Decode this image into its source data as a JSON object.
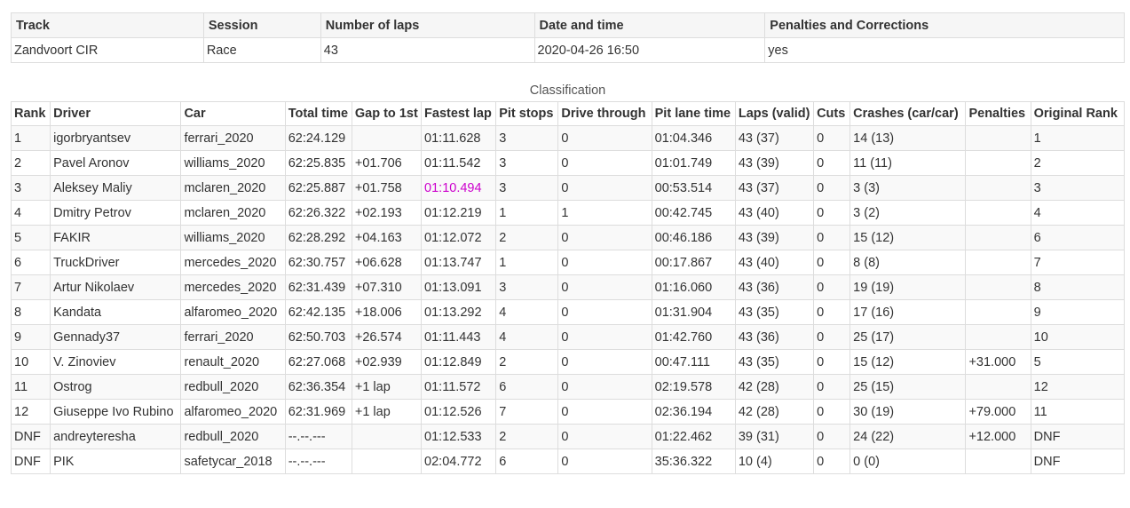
{
  "session": {
    "headers": [
      "Track",
      "Session",
      "Number of laps",
      "Date and time",
      "Penalties and Corrections"
    ],
    "values": [
      "Zandvoort CIR",
      "Race",
      "43",
      "2020-04-26 16:50",
      "yes"
    ]
  },
  "classification": {
    "caption": "Classification",
    "headers": [
      "Rank",
      "Driver",
      "Car",
      "Total time",
      "Gap to 1st",
      "Fastest lap",
      "Pit stops",
      "Drive through",
      "Pit lane time",
      "Laps (valid)",
      "Cuts",
      "Crashes (car/car)",
      "Penalties",
      "Original Rank"
    ],
    "highlight_color": "#cc00cc",
    "rows": [
      [
        "1",
        "igorbryantsev",
        "ferrari_2020",
        "62:24.129",
        "",
        "01:11.628",
        "3",
        "0",
        "01:04.346",
        "43 (37)",
        "0",
        "14 (13)",
        "",
        "1"
      ],
      [
        "2",
        "Pavel Aronov",
        "williams_2020",
        "62:25.835",
        "+01.706",
        "01:11.542",
        "3",
        "0",
        "01:01.749",
        "43 (39)",
        "0",
        "11 (11)",
        "",
        "2"
      ],
      [
        "3",
        "Aleksey Maliy",
        "mclaren_2020",
        "62:25.887",
        "+01.758",
        "01:10.494",
        "3",
        "0",
        "00:53.514",
        "43 (37)",
        "0",
        "3 (3)",
        "",
        "3"
      ],
      [
        "4",
        "Dmitry Petrov",
        "mclaren_2020",
        "62:26.322",
        "+02.193",
        "01:12.219",
        "1",
        "1",
        "00:42.745",
        "43 (40)",
        "0",
        "3 (2)",
        "",
        "4"
      ],
      [
        "5",
        "FAKIR",
        "williams_2020",
        "62:28.292",
        "+04.163",
        "01:12.072",
        "2",
        "0",
        "00:46.186",
        "43 (39)",
        "0",
        "15 (12)",
        "",
        "6"
      ],
      [
        "6",
        "TruckDriver",
        "mercedes_2020",
        "62:30.757",
        "+06.628",
        "01:13.747",
        "1",
        "0",
        "00:17.867",
        "43 (40)",
        "0",
        "8 (8)",
        "",
        "7"
      ],
      [
        "7",
        "Artur Nikolaev",
        "mercedes_2020",
        "62:31.439",
        "+07.310",
        "01:13.091",
        "3",
        "0",
        "01:16.060",
        "43 (36)",
        "0",
        "19 (19)",
        "",
        "8"
      ],
      [
        "8",
        "Kandata",
        "alfaromeo_2020",
        "62:42.135",
        "+18.006",
        "01:13.292",
        "4",
        "0",
        "01:31.904",
        "43 (35)",
        "0",
        "17 (16)",
        "",
        "9"
      ],
      [
        "9",
        "Gennady37",
        "ferrari_2020",
        "62:50.703",
        "+26.574",
        "01:11.443",
        "4",
        "0",
        "01:42.760",
        "43 (36)",
        "0",
        "25 (17)",
        "",
        "10"
      ],
      [
        "10",
        "V. Zinoviev",
        "renault_2020",
        "62:27.068",
        "+02.939",
        "01:12.849",
        "2",
        "0",
        "00:47.111",
        "43 (35)",
        "0",
        "15 (12)",
        "+31.000",
        "5"
      ],
      [
        "11",
        "Ostrog",
        "redbull_2020",
        "62:36.354",
        "+1 lap",
        "01:11.572",
        "6",
        "0",
        "02:19.578",
        "42 (28)",
        "0",
        "25 (15)",
        "",
        "12"
      ],
      [
        "12",
        "Giuseppe Ivo Rubino",
        "alfaromeo_2020",
        "62:31.969",
        "+1 lap",
        "01:12.526",
        "7",
        "0",
        "02:36.194",
        "42 (28)",
        "0",
        "30 (19)",
        "+79.000",
        "11"
      ],
      [
        "DNF",
        "andreyteresha",
        "redbull_2020",
        "--.--.---",
        "",
        "01:12.533",
        "2",
        "0",
        "01:22.462",
        "39 (31)",
        "0",
        "24 (22)",
        "+12.000",
        "DNF"
      ],
      [
        "DNF",
        "PIK",
        "safetycar_2018",
        "--.--.---",
        "",
        "02:04.772",
        "6",
        "0",
        "35:36.322",
        "10 (4)",
        "0",
        "0 (0)",
        "",
        "DNF"
      ]
    ],
    "fastest_lap_row": 2
  }
}
